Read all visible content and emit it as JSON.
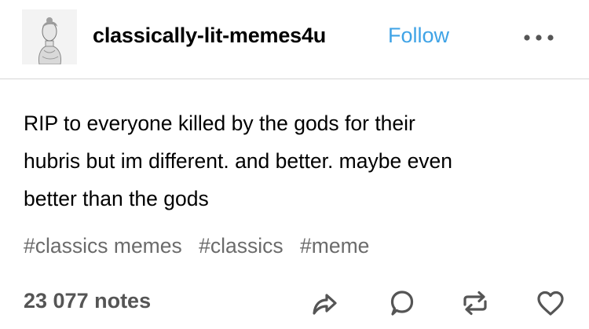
{
  "post": {
    "blog_name": "classically-lit-memes4u",
    "follow_label": "Follow",
    "more_icon": "more-horizontal-icon",
    "body": "RIP to everyone killed by the gods for their\nhubris but im different. and better. maybe even\nbetter than the gods",
    "tags": [
      "#classics memes",
      "#classics",
      "#meme"
    ],
    "notes": "23 077 notes",
    "actions": [
      "share-icon",
      "reply-icon",
      "reblog-icon",
      "like-icon"
    ]
  },
  "colors": {
    "follow": "#3fa3e6",
    "tags": "#6b6b6b",
    "notes": "#555555",
    "divider": "#d6d6d6"
  }
}
